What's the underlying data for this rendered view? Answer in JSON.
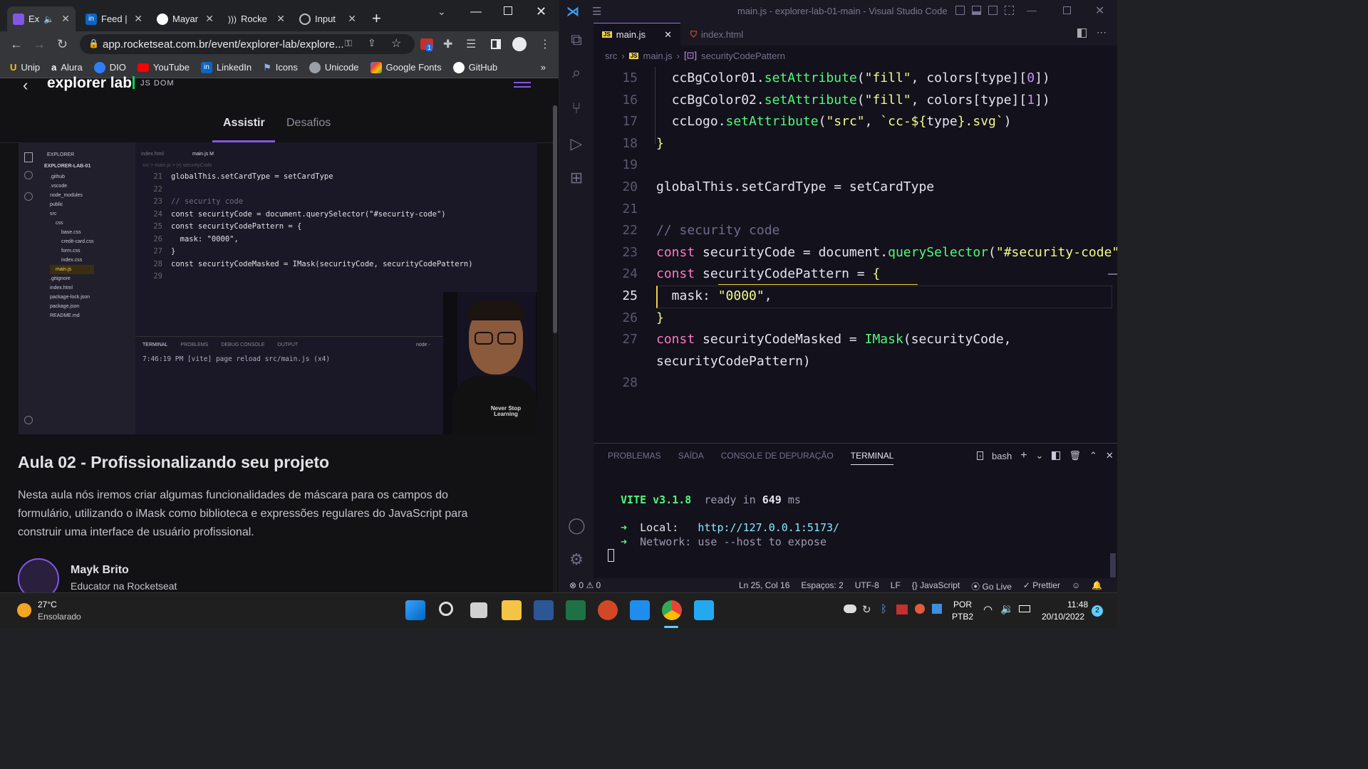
{
  "browser": {
    "tabs": [
      {
        "label": "Ex",
        "icon": "rocketseat-icon"
      },
      {
        "label": "Feed |",
        "icon": "linkedin-icon"
      },
      {
        "label": "Mayar",
        "icon": "github-icon"
      },
      {
        "label": "Rocke",
        "icon": "podcast-icon"
      },
      {
        "label": "Input",
        "icon": "globe-icon"
      }
    ],
    "new_tab": "+",
    "url": "app.rocketseat.com.br/event/explorer-lab/explore...",
    "extension_badge": "1",
    "bookmarks": [
      "Unip",
      "Alura",
      "DIO",
      "YouTube",
      "LinkedIn",
      "Icons",
      "Unicode",
      "Google Fonts",
      "GitHub"
    ],
    "bookmarks_more": "»"
  },
  "page": {
    "header_title": "explorer lab",
    "header_sub": "JS DOM",
    "tabs": [
      "Assistir",
      "Desafios"
    ],
    "video": {
      "explorer_title": "EXPLORER",
      "project": "EXPLORER-LAB-01",
      "tree": [
        ".github",
        ".vscode",
        "node_modules",
        "public",
        "src",
        "css",
        "base.css",
        "credit-card.css",
        "form.css",
        "index.css",
        "main.js",
        ".gitignore",
        "index.html",
        "package-lock.json",
        "package.json",
        "README.md"
      ],
      "tabs": [
        "index.html",
        "main.js M"
      ],
      "crumbs": "src > main.js > {•} securityCode",
      "lines": [
        {
          "n": "21",
          "t": "globalThis.setCardType = setCardType"
        },
        {
          "n": "22",
          "t": ""
        },
        {
          "n": "23",
          "t": "// security code"
        },
        {
          "n": "24",
          "t": "const securityCode = document.querySelector(\"#security-code\")"
        },
        {
          "n": "25",
          "t": "const securityCodePattern = {"
        },
        {
          "n": "26",
          "t": "  mask: \"0000\","
        },
        {
          "n": "27",
          "t": "}"
        },
        {
          "n": "28",
          "t": "const securityCodeMasked = IMask(securityCode, securityCodePattern)"
        },
        {
          "n": "29",
          "t": ""
        }
      ],
      "terminal_tabs": [
        "TERMINAL",
        "PROBLEMS",
        "DEBUG CONSOLE",
        "OUTPUT"
      ],
      "terminal_node": "node - ",
      "terminal_line": "7:46:19 PM [vite] page reload src/main.js (x4)",
      "shirt_text": "Never Stop Learning"
    },
    "lesson_title": "Aula 02 - Profissionalizando seu projeto",
    "lesson_desc": "Nesta aula nós iremos criar algumas funcionalidades de máscara para os campos do formulário, utilizando o iMask como biblioteca e expressões regulares do JavaScript para construir uma interface de usuário profissional.",
    "author_name": "Mayk Brito",
    "author_role": "Educator na Rocketseat"
  },
  "vscode": {
    "title": "main.js - explorer-lab-01-main - Visual Studio Code",
    "tabs": [
      "main.js",
      "index.html"
    ],
    "crumbs": [
      "src",
      "main.js",
      "securityCodePattern"
    ],
    "panel_tabs": [
      "PROBLEMAS",
      "SAÍDA",
      "CONSOLE DE DEPURAÇÃO",
      "TERMINAL"
    ],
    "shell": "bash",
    "terminal": {
      "vite": "VITE v3.1.8",
      "ready": "ready in",
      "ms_value": "649",
      "ms": "ms",
      "local_label": "Local:",
      "local_url": "http://127.0.0.1:5173/",
      "network_label": "Network:",
      "network_text": "use --host to expose"
    },
    "status": {
      "errors": "0",
      "warnings": "0",
      "position": "Ln 25, Col 16",
      "spaces": "Espaços: 2",
      "encoding": "UTF-8",
      "eol": "LF",
      "language": "JavaScript",
      "golive": "Go Live",
      "prettier": "Prettier"
    }
  },
  "taskbar": {
    "temp": "27°C",
    "weather": "Ensolarado",
    "lang": "POR",
    "layout": "PTB2",
    "time": "11:48",
    "date": "20/10/2022",
    "notif": "2"
  }
}
